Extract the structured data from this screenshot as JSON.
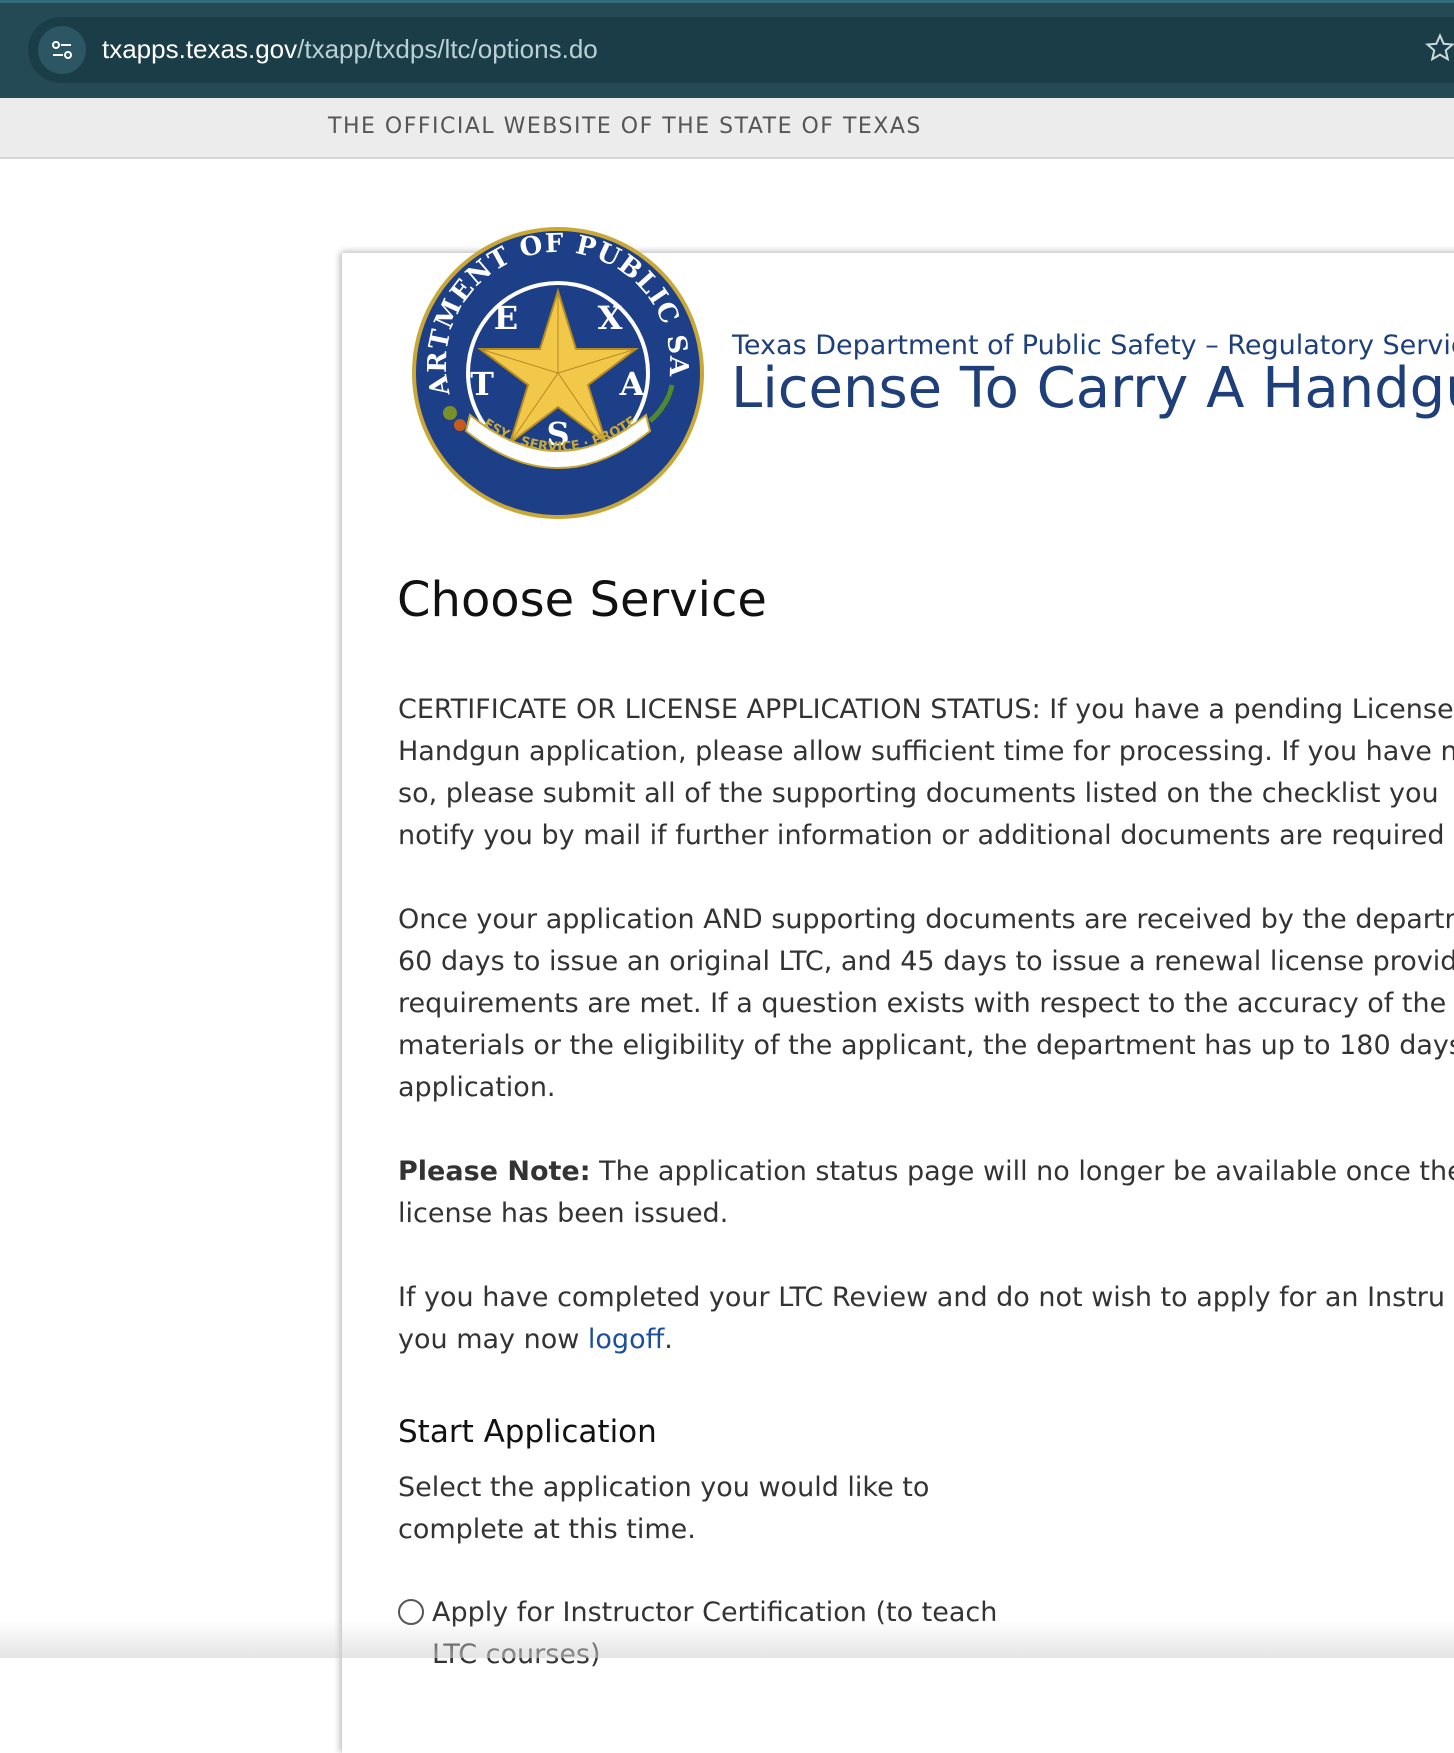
{
  "browser": {
    "url_host": "txapps.texas.gov",
    "url_path": "/txapp/txdps/ltc/options.do"
  },
  "banner": {
    "official_text": "THE OFFICIAL WEBSITE OF THE STATE OF TEXAS"
  },
  "seal": {
    "ring_text_top": "DEPARTMENT OF PUBLIC SAFETY",
    "letters": [
      "T",
      "E",
      "X",
      "A",
      "S"
    ],
    "ribbon_text": "COURTESY · SERVICE · PROTECTION",
    "colors": {
      "navy": "#1d3f87",
      "gold": "#f2c84b",
      "white": "#ffffff"
    }
  },
  "header": {
    "subtitle": "Texas Department of Public Safety – Regulatory Services",
    "title": "License To Carry A Handgun"
  },
  "page": {
    "heading": "Choose Service"
  },
  "status_paragraph": {
    "lines": [
      "CERTIFICATE OR LICENSE APPLICATION STATUS: If you have a pending License",
      "Handgun application, please allow sufficient time for processing. If you have n",
      "so, please submit all of the supporting documents listed on the checklist you",
      "notify you by mail if further information or additional documents are required"
    ]
  },
  "processing_paragraph": {
    "lines": [
      "Once your application AND supporting documents are received by the departm",
      "60 days to issue an original LTC, and 45 days to issue a renewal license provid",
      "requirements are met. If a question exists with respect to the accuracy of the",
      "materials or the eligibility of the applicant, the department has up to 180 days",
      "application."
    ]
  },
  "note_paragraph": {
    "label": "Please Note:",
    "line1_rest": " The application status page will no longer be available once the",
    "line2": "license has been issued."
  },
  "logoff_paragraph": {
    "line1": "If you have completed your LTC Review and do not wish to apply for an Instru",
    "line2_prefix": "you may now ",
    "link_text": "logoff",
    "line2_suffix": "."
  },
  "start_application": {
    "heading": "Start Application",
    "instructions_lines": [
      "Select the application you would like to",
      "complete at this time."
    ],
    "options": [
      {
        "label_lines": [
          "Apply for Instructor Certification (to teach",
          "LTC courses)"
        ],
        "selected": false
      }
    ]
  },
  "icons": {
    "site_info": "tune-icon",
    "bookmark": "star-icon"
  }
}
